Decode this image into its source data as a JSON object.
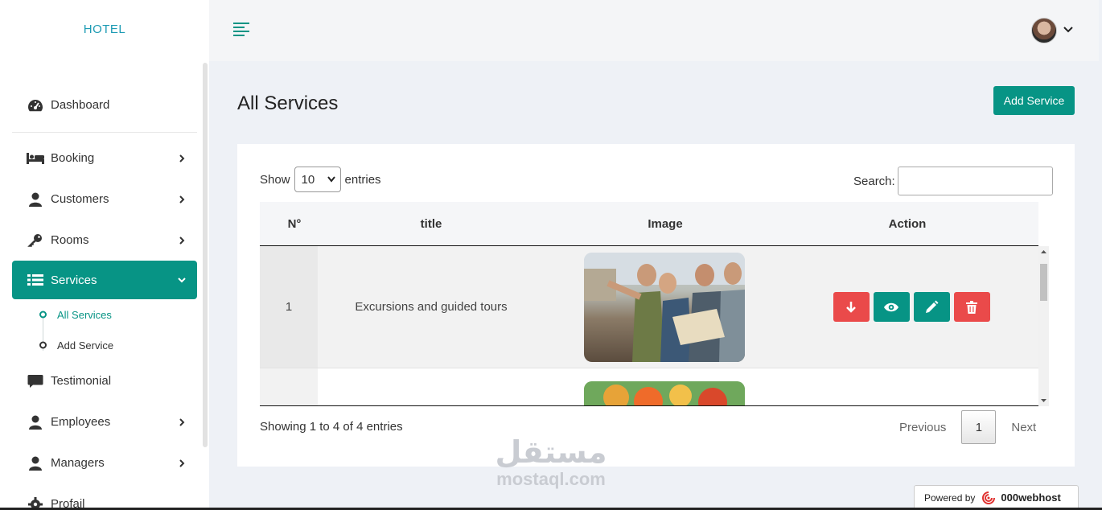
{
  "sidebar": {
    "brand": "HOTEL",
    "items": [
      {
        "label": "Dashboard",
        "icon": "dashboard-gauge-icon"
      },
      {
        "label": "Booking",
        "icon": "bed-icon"
      },
      {
        "label": "Customers",
        "icon": "user-icon"
      },
      {
        "label": "Rooms",
        "icon": "key-icon"
      },
      {
        "label": "Services",
        "icon": "list-icon"
      },
      {
        "label": "Testimonial",
        "icon": "comment-icon"
      },
      {
        "label": "Employees",
        "icon": "user-icon"
      },
      {
        "label": "Managers",
        "icon": "user-icon"
      },
      {
        "label": "Profail",
        "icon": "gear-icon"
      }
    ],
    "services_sub": [
      {
        "label": "All Services"
      },
      {
        "label": "Add Service"
      }
    ]
  },
  "page": {
    "title": "All Services",
    "add_button": "Add Service"
  },
  "table_controls": {
    "show_label": "Show",
    "entries_value": "10",
    "entries_label": "entries",
    "search_label": "Search:"
  },
  "table": {
    "columns": [
      "N°",
      "title",
      "Image",
      "Action"
    ],
    "rows": [
      {
        "n": "1",
        "title": "Excursions and guided tours",
        "image": "tourists-with-map-photo"
      },
      {
        "n": "",
        "title": "",
        "image": "food-plate-photo"
      }
    ]
  },
  "footer": {
    "showing": "Showing 1 to 4 of 4 entries",
    "previous": "Previous",
    "page": "1",
    "next": "Next"
  },
  "watermark": {
    "arabic": "مستقل",
    "latin": "mostaql.com"
  },
  "powered": {
    "label": "Powered by",
    "brand": "000webhost"
  },
  "colors": {
    "accent": "#079485",
    "danger": "#ea4a4a",
    "brand_text": "#1d9bb4"
  }
}
